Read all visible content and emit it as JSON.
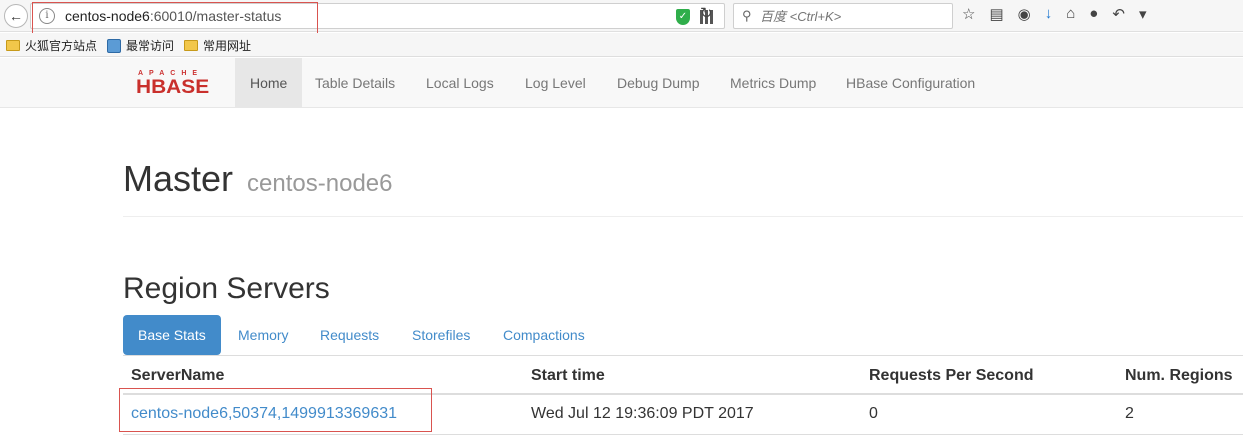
{
  "browser": {
    "url_host": "centos-node6",
    "url_path": ":60010/master-status",
    "search_placeholder": "百度 <Ctrl+K>",
    "bookmarks": [
      "火狐官方站点",
      "最常访问",
      "常用网址"
    ]
  },
  "navbar": {
    "logo_top": "APACHE",
    "logo_main": "HBASE",
    "links": [
      "Home",
      "Table Details",
      "Local Logs",
      "Log Level",
      "Debug Dump",
      "Metrics Dump",
      "HBase Configuration"
    ]
  },
  "page": {
    "title": "Master",
    "subtitle": "centos-node6"
  },
  "region_servers": {
    "title": "Region Servers",
    "tabs": [
      "Base Stats",
      "Memory",
      "Requests",
      "Storefiles",
      "Compactions"
    ],
    "columns": [
      "ServerName",
      "Start time",
      "Requests Per Second",
      "Num. Regions"
    ],
    "rows": [
      {
        "server": "centos-node6,50374,1499913369631",
        "start": "Wed Jul 12 19:36:09 PDT 2017",
        "rps": "0",
        "regions": "2"
      }
    ]
  },
  "colors": {
    "accent": "#428bca",
    "highlight": "#d9534f",
    "logo": "#c9302c"
  }
}
